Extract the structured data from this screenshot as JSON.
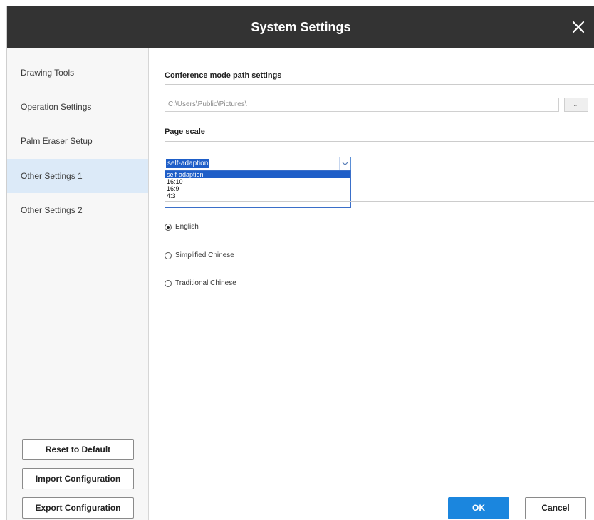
{
  "window": {
    "title": "System Settings",
    "close_icon": "close-icon"
  },
  "sidebar": {
    "items": [
      {
        "label": "Drawing Tools"
      },
      {
        "label": "Operation Settings"
      },
      {
        "label": "Palm Eraser Setup"
      },
      {
        "label": "Other Settings 1",
        "active": true
      },
      {
        "label": "Other Settings 2"
      }
    ],
    "buttons": {
      "reset": "Reset to Default",
      "import": "Import Configuration",
      "export": "Export Configuration"
    }
  },
  "content": {
    "conference_path": {
      "title": "Conference mode path settings",
      "value": "C:\\Users\\Public\\Pictures\\",
      "browse_label": "..."
    },
    "page_scale": {
      "title": "Page scale",
      "selected": "self-adaption",
      "options": [
        "self-adaption",
        "16:10",
        "16:9",
        "4:3"
      ]
    },
    "language": {
      "options": [
        {
          "label": "English",
          "checked": true
        },
        {
          "label": "Simplified Chinese",
          "checked": false
        },
        {
          "label": "Traditional Chinese",
          "checked": false
        }
      ]
    }
  },
  "footer": {
    "ok": "OK",
    "cancel": "Cancel"
  },
  "colors": {
    "titlebar": "#333333",
    "accent": "#1b86de",
    "sidebar_active": "#dceaf8",
    "selection": "#1e5ec8"
  }
}
